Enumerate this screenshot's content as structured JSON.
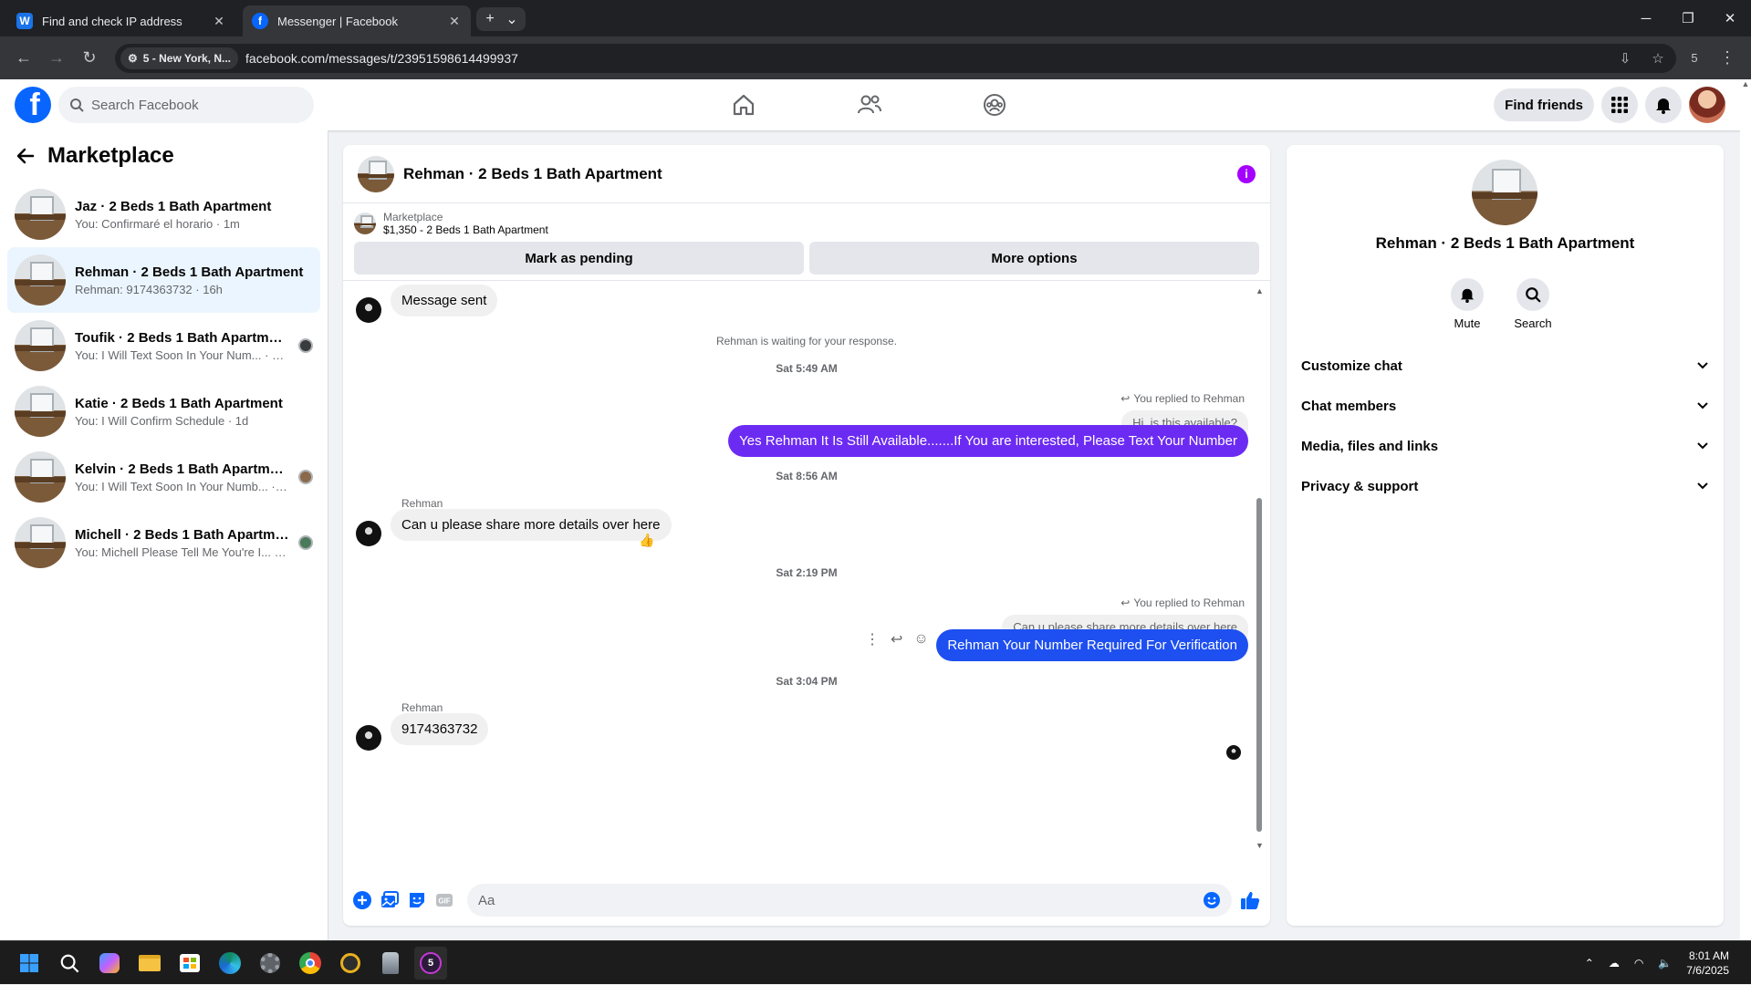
{
  "browser": {
    "tabs": [
      {
        "title": "Find and check IP address",
        "favicon": "W",
        "active": false
      },
      {
        "title": "Messenger | Facebook",
        "favicon": "f",
        "active": true
      }
    ],
    "location_chip": "5 - New York, N...",
    "url": "facebook.com/messages/t/23951598614499937",
    "profile_badge": "5"
  },
  "fb": {
    "search_placeholder": "Search Facebook",
    "find_friends": "Find friends"
  },
  "sidebar": {
    "title": "Marketplace",
    "conversations": [
      {
        "name": "Jaz · 2 Beds 1 Bath Apartment",
        "last": "You: Confirmaré el horario · 1m"
      },
      {
        "name": "Rehman · 2 Beds 1 Bath Apartment",
        "last": "Rehman: 9174363732 · 16h",
        "active": true
      },
      {
        "name": "Toufik · 2 Beds 1 Bath Apartment",
        "last": "You: I Will Text Soon In Your Num... · 17h"
      },
      {
        "name": "Katie · 2 Beds 1 Bath Apartment",
        "last": "You: I Will Confirm Schedule · 1d"
      },
      {
        "name": "Kelvin · 2 Beds 1 Bath Apartment",
        "last": "You: I Will Text Soon In Your Numb... · 2d"
      },
      {
        "name": "Michell · 2 Beds 1 Bath Apartment",
        "last": "You: Michell Please Tell Me You're I... · 2d"
      }
    ]
  },
  "chat": {
    "title": "Rehman · 2 Beds 1 Bath Apartment",
    "listing_source": "Marketplace",
    "listing_detail": "$1,350 - 2 Beds 1 Bath Apartment",
    "btn_pending": "Mark as pending",
    "btn_more": "More options",
    "messages": {
      "msg_sent": "Message sent",
      "waiting": "Rehman is waiting for your response.",
      "ts1": "Sat 5:49 AM",
      "replied1": "You replied to Rehman",
      "quote1": "Hi, is this available?",
      "out1": "Yes Rehman It Is Still Available.......If You are interested, Please Text Your Number",
      "ts2": "Sat 8:56 AM",
      "sender1": "Rehman",
      "in1": "Can u please share more details over here",
      "reaction1": "👍",
      "ts3": "Sat 2:19 PM",
      "replied2": "You replied to Rehman",
      "quote2": "Can u please share more details over here",
      "out2": "Rehman Your Number Required For Verification",
      "ts4": "Sat 3:04 PM",
      "sender2": "Rehman",
      "in2": "9174363732"
    },
    "composer_placeholder": "Aa",
    "colors": {
      "purple": "#6c2bf2",
      "blue": "#1e4ff0"
    }
  },
  "details": {
    "title": "Rehman · 2 Beds 1 Bath Apartment",
    "mute": "Mute",
    "search": "Search",
    "sections": [
      "Customize chat",
      "Chat members",
      "Media, files and links",
      "Privacy & support"
    ]
  },
  "taskbar": {
    "time": "8:01 AM",
    "date": "7/6/2025"
  }
}
